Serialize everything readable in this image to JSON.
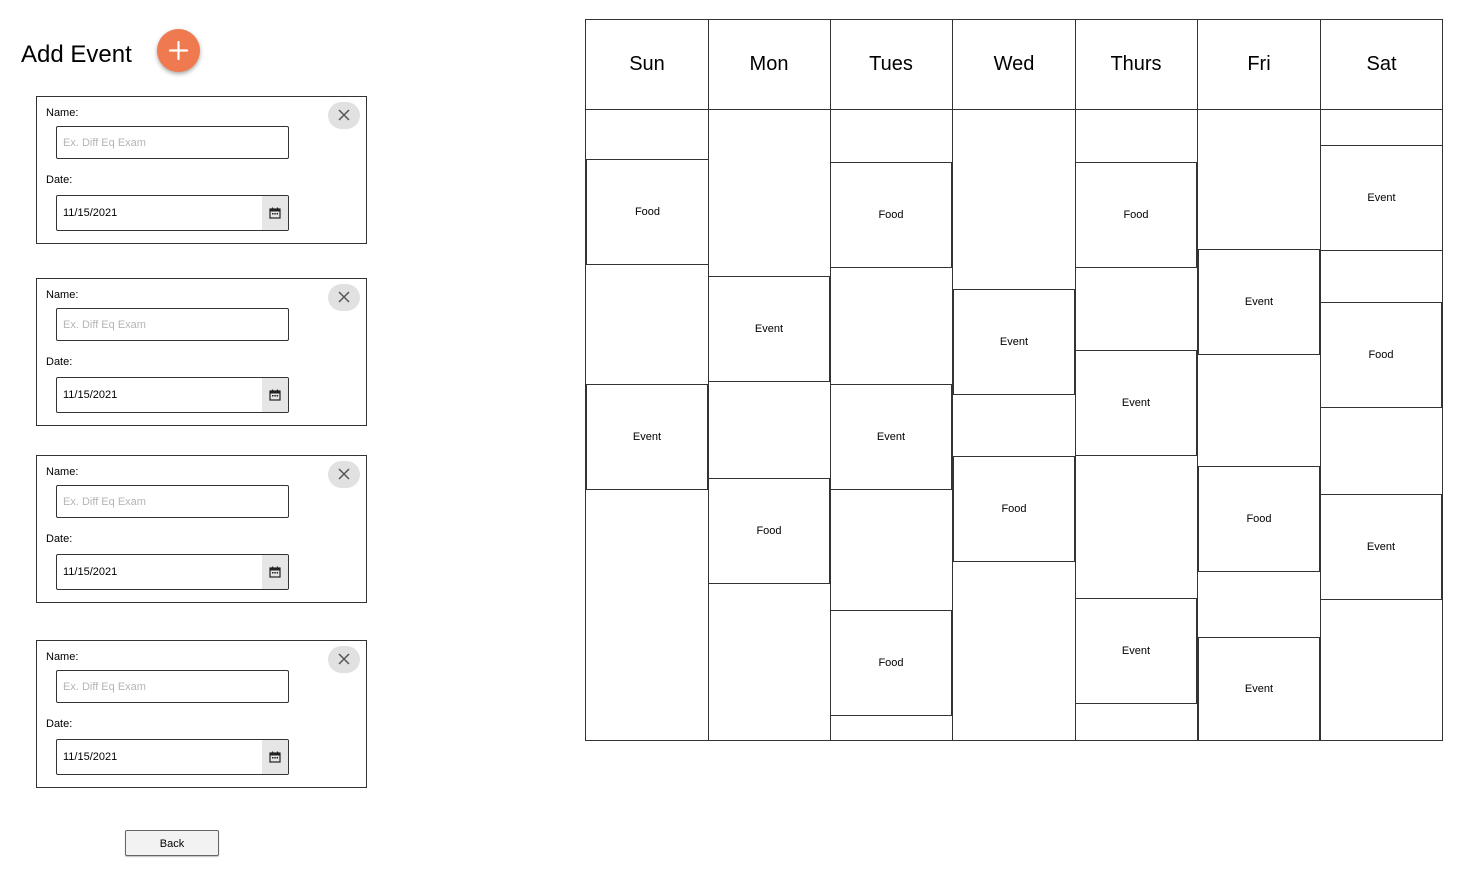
{
  "page": {
    "title": "Add Event"
  },
  "form": {
    "name_label": "Name:",
    "date_label": "Date:",
    "name_placeholder": "Ex. Diff Eq Exam",
    "entries": [
      {
        "date": "11/15/2021"
      },
      {
        "date": "11/15/2021"
      },
      {
        "date": "11/15/2021"
      },
      {
        "date": "11/15/2021"
      }
    ],
    "back_label": "Back"
  },
  "calendar": {
    "days": [
      {
        "name": "Sun",
        "blocks": [
          {
            "label": "Food"
          },
          {
            "label": "Event"
          }
        ]
      },
      {
        "name": "Mon",
        "blocks": [
          {
            "label": "Event"
          },
          {
            "label": "Food"
          }
        ]
      },
      {
        "name": "Tues",
        "blocks": [
          {
            "label": "Food"
          },
          {
            "label": "Event"
          },
          {
            "label": "Food"
          }
        ]
      },
      {
        "name": "Wed",
        "blocks": [
          {
            "label": "Event"
          },
          {
            "label": "Food"
          }
        ]
      },
      {
        "name": "Thurs",
        "blocks": [
          {
            "label": "Food"
          },
          {
            "label": "Event"
          },
          {
            "label": "Event"
          }
        ]
      },
      {
        "name": "Fri",
        "blocks": [
          {
            "label": "Event"
          },
          {
            "label": "Food"
          },
          {
            "label": "Event"
          }
        ]
      },
      {
        "name": "Sat",
        "blocks": [
          {
            "label": "Event"
          },
          {
            "label": "Food"
          },
          {
            "label": "Event"
          }
        ]
      }
    ]
  },
  "colors": {
    "accent": "#ef7a50"
  }
}
